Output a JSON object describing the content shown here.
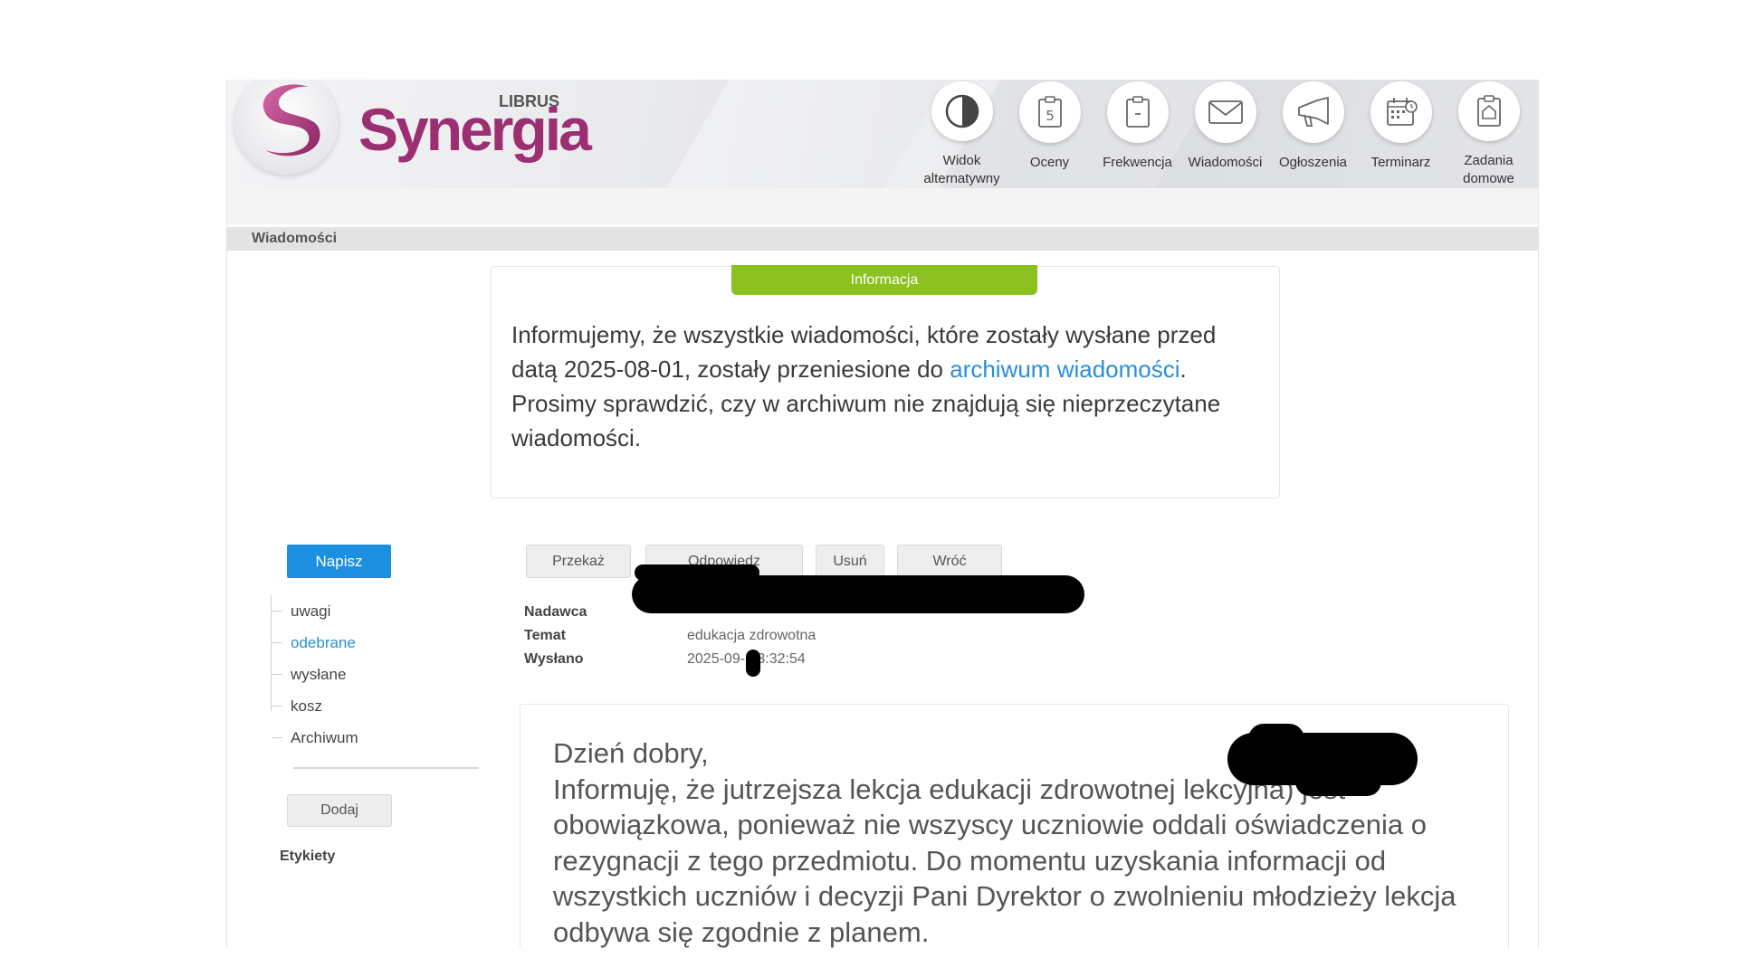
{
  "header": {
    "logo_text": "Synergia",
    "logo_sub": "LIBRUS",
    "nav": [
      {
        "label": "Widok alternatywny",
        "icon": "contrast-icon"
      },
      {
        "label": "Oceny",
        "icon": "grades-icon"
      },
      {
        "label": "Frekwencja",
        "icon": "attendance-icon"
      },
      {
        "label": "Wiadomości",
        "icon": "envelope-icon"
      },
      {
        "label": "Ogłoszenia",
        "icon": "megaphone-icon"
      },
      {
        "label": "Terminarz",
        "icon": "calendar-icon"
      },
      {
        "label": "Zadania domowe",
        "icon": "homework-icon"
      }
    ]
  },
  "breadcrumb": "Wiadomości",
  "info": {
    "title": "Informacja",
    "text_before": "Informujemy, że wszystkie wiadomości, które zostały wysłane przed datą 2025-08-01, zostały przeniesione do ",
    "link": "archiwum wiadomości",
    "text_after": ". Prosimy sprawdzić, czy w archiwum nie znajdują się nieprzeczytane wiadomości."
  },
  "sidebar": {
    "compose": "Napisz",
    "folders": [
      "uwagi",
      "odebrane",
      "wysłane",
      "kosz",
      "Archiwum"
    ],
    "active_folder": "odebrane",
    "add": "Dodaj",
    "labels_title": "Etykiety"
  },
  "toolbar": {
    "forward": "Przekaż",
    "reply": "Odpowiedz",
    "delete": "Usuń",
    "back": "Wróć"
  },
  "message": {
    "sender_label": "Nadawca",
    "sender_value": "",
    "subject_label": "Temat",
    "subject_value": "edukacja zdrowotna",
    "sent_label": "Wysłano",
    "sent_value": "2025-09-  13:32:54",
    "greeting": "Dzień dobry,",
    "body": "Informuję, że jutrzejsza lekcja edukacji zdrowotnej           lekcyjna) jest obowiązkowa, ponieważ nie wszyscy uczniowie oddali oświadczenia o rezygnacji z tego przedmiotu. Do momentu uzyskania informacji od wszystkich uczniów i decyzji Pani Dyrektor o zwolnieniu młodzieży lekcja odbywa się zgodnie z planem."
  },
  "colors": {
    "accent_blue": "#1d8fe0",
    "info_green": "#8cc21f",
    "brand_magenta": "#9b2f72",
    "link_blue": "#2a8fd6"
  }
}
